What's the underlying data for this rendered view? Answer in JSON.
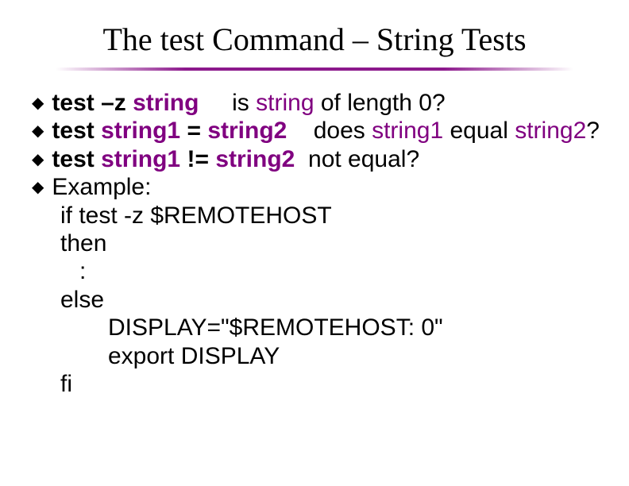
{
  "title": "The test Command – String Tests",
  "bullets": [
    {
      "cmd_test": "test",
      "cmd_rest": " –z ",
      "arg1": "string",
      "gap": "     ",
      "desc_pre": "is ",
      "desc_arg": "string",
      "desc_post": " of length 0?"
    },
    {
      "cmd_test": "test",
      "cmd_rest": " ",
      "arg1": "string1",
      "op": " = ",
      "arg2": "string2",
      "gap": "    ",
      "desc_pre": "does ",
      "desc_arg1": "string1",
      "desc_mid": " equal ",
      "desc_arg2": "string2",
      "desc_post": "?"
    },
    {
      "cmd_test": "test",
      "cmd_rest": " ",
      "arg1": "string1",
      "op": " != ",
      "arg2": "string2",
      "gap": "  ",
      "desc": "not equal?"
    },
    {
      "example_label": "Example:"
    }
  ],
  "code": {
    "l1": "if test -z $REMOTEHOST",
    "l2": "then",
    "l3": ":",
    "l4": "else",
    "l5": "DISPLAY=\"$REMOTEHOST: 0\"",
    "l6": "export DISPLAY",
    "l7": "fi"
  }
}
